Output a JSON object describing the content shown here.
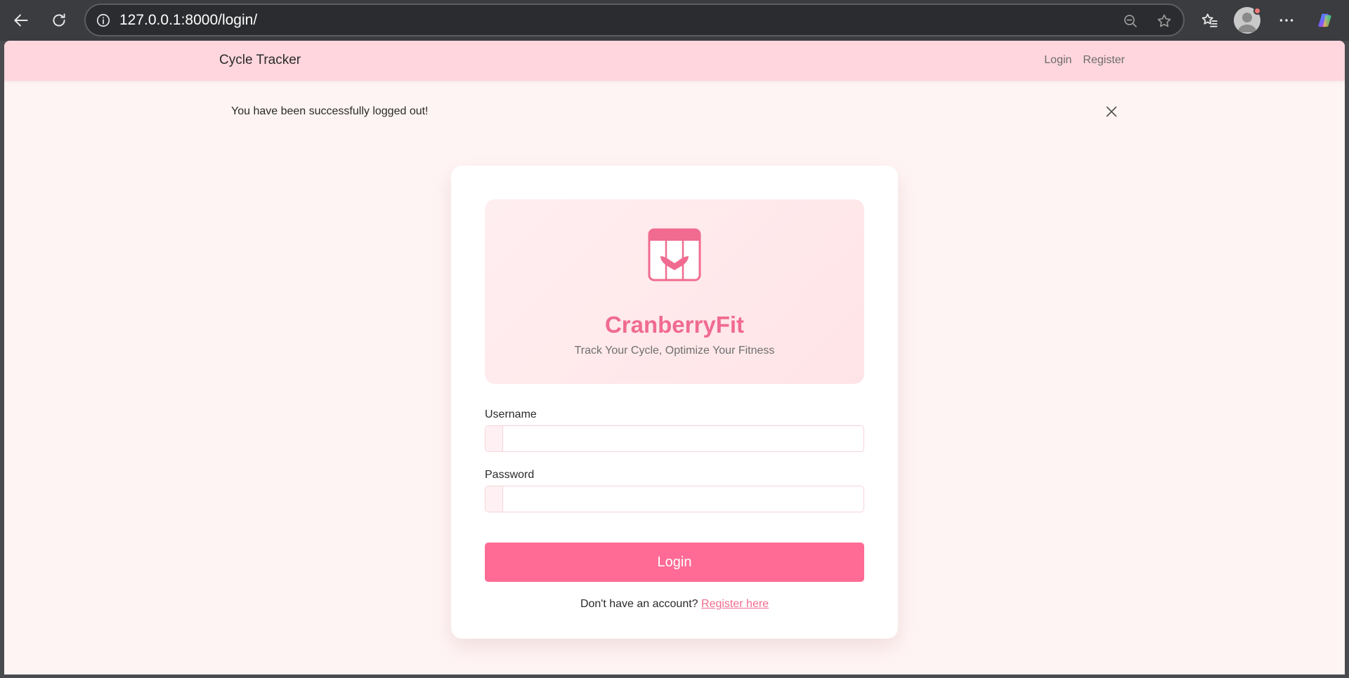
{
  "browser": {
    "url": "127.0.0.1:8000/login/"
  },
  "navbar": {
    "brand": "Cycle Tracker",
    "links": [
      "Login",
      "Register"
    ]
  },
  "alert": {
    "message": "You have been successfully logged out!"
  },
  "card": {
    "title": "CranberryFit",
    "subtitle": "Track Your Cycle, Optimize Your Fitness",
    "username_label": "Username",
    "password_label": "Password",
    "username_value": "",
    "password_value": "",
    "login_button": "Login",
    "register_prompt": "Don't have an account?",
    "register_link": "Register here"
  },
  "colors": {
    "accent": "#ff6b95",
    "brand_text": "#f06b8f",
    "navbar_bg": "#ffd6de",
    "page_bg": "#fff4f4"
  },
  "icons": {
    "hero": "calendar-heart-icon"
  }
}
